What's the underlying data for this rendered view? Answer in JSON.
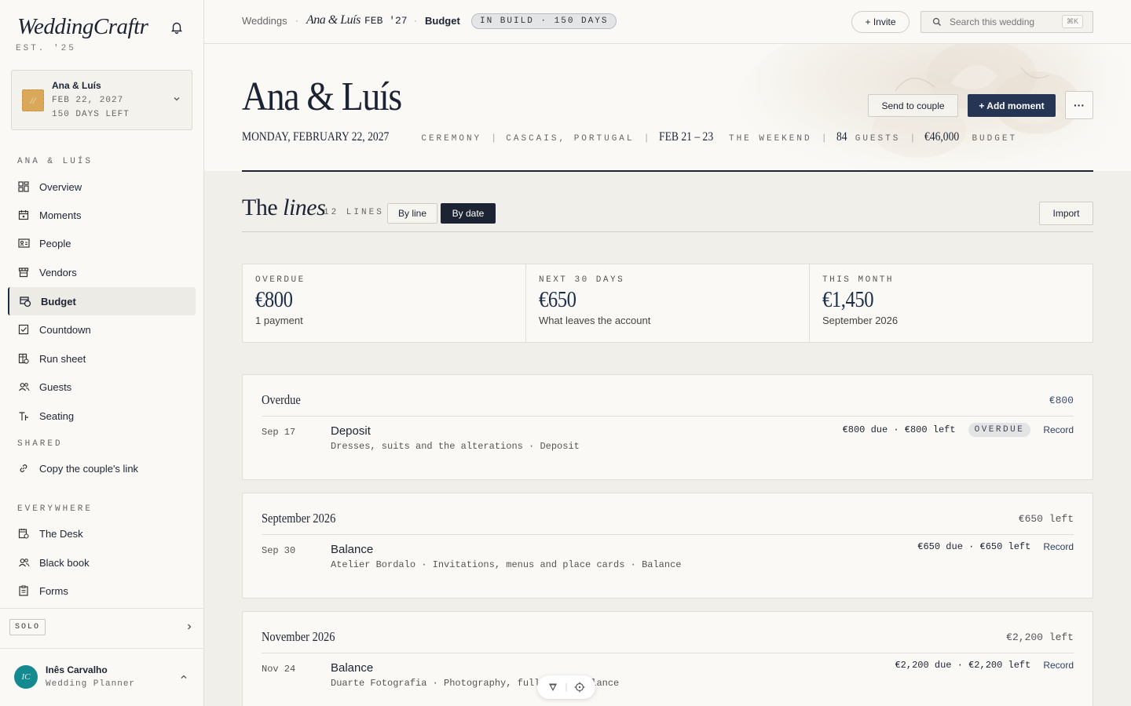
{
  "brand": {
    "name": "WeddingCraftr",
    "est": "EST. '25"
  },
  "wedding_card": {
    "monogram": "//",
    "name": "Ana & Luís",
    "date": "FEB 22, 2027",
    "days": "150 DAYS LEFT"
  },
  "nav": {
    "section_main": "ANA & LUÍS",
    "items": [
      {
        "label": "Overview",
        "icon": "grid-icon"
      },
      {
        "label": "Moments",
        "icon": "calendar-icon"
      },
      {
        "label": "People",
        "icon": "id-card-icon"
      },
      {
        "label": "Vendors",
        "icon": "store-icon"
      },
      {
        "label": "Budget",
        "icon": "budget-icon"
      },
      {
        "label": "Countdown",
        "icon": "checkbox-icon"
      },
      {
        "label": "Run sheet",
        "icon": "run-sheet-icon"
      },
      {
        "label": "Guests",
        "icon": "users-icon"
      },
      {
        "label": "Seating",
        "icon": "seating-icon"
      }
    ],
    "section_shared": "SHARED",
    "shared_items": [
      {
        "label": "Copy the couple's link",
        "icon": "link-icon"
      }
    ],
    "section_everywhere": "EVERYWHERE",
    "everywhere_items": [
      {
        "label": "The Desk",
        "icon": "desk-icon"
      },
      {
        "label": "Black book",
        "icon": "users-icon"
      },
      {
        "label": "Forms",
        "icon": "form-icon"
      }
    ]
  },
  "plan": {
    "label": "SOLO"
  },
  "user": {
    "initials": "IC",
    "name": "Inês Carvalho",
    "role": "Wedding Planner"
  },
  "topbar": {
    "crumb_root": "Weddings",
    "crumb_wedding": "Ana & Luís",
    "crumb_wedding_date": "FEB '27",
    "crumb_page": "Budget",
    "status_pill": "IN BUILD · 150 DAYS",
    "invite_label": "+ Invite",
    "search_placeholder": "Search this wedding",
    "search_kbd": "⌘K"
  },
  "hero": {
    "title": "Ana & Luís",
    "date": "MONDAY, FEBRUARY 22, 2027",
    "date_label": "CEREMONY",
    "location": "CASCAIS, PORTUGAL",
    "weekend": "FEB 21 – 23",
    "weekend_label": "THE WEEKEND",
    "guests": "84",
    "guests_label": "GUESTS",
    "budget": "€46,000",
    "budget_label": "BUDGET",
    "send_label": "Send to couple",
    "add_label": "+ Add moment",
    "more_label": "···"
  },
  "lines": {
    "title_a": "The ",
    "title_b": "lines",
    "count": "12 LINES",
    "by_line": "By line",
    "by_date": "By date",
    "import": "Import"
  },
  "stats": [
    {
      "label": "OVERDUE",
      "value": "€800",
      "sub": "1 payment"
    },
    {
      "label": "NEXT 30 DAYS",
      "value": "€650",
      "sub": "What leaves the account"
    },
    {
      "label": "THIS MONTH",
      "value": "€1,450",
      "sub": "September 2026"
    }
  ],
  "groups": [
    {
      "title": "Overdue",
      "total": "€800",
      "row": {
        "date": "Sep 17",
        "title": "Deposit",
        "sub": "Dresses, suits and the alterations · Deposit",
        "amount": "€800 due · €800 left",
        "badge": "OVERDUE",
        "action": "Record"
      }
    },
    {
      "title": "September 2026",
      "total": "€650 left",
      "row": {
        "date": "Sep 30",
        "title": "Balance",
        "sub": "Atelier Bordalo · Invitations, menus and place cards · Balance",
        "amount": "€650 due · €650 left",
        "action": "Record"
      }
    },
    {
      "title": "November 2026",
      "total": "€2,200 left",
      "row": {
        "date": "Nov 24",
        "title": "Balance",
        "sub": "Duarte Fotografia · Photography, full day · Balance",
        "amount": "€2,200 due · €2,200 left",
        "action": "Record"
      }
    }
  ],
  "colors": {
    "accent": "#253553",
    "ink": "#1c2333",
    "paper": "#faf9f5",
    "badge": "#d9a85b",
    "avatar": "#138a8f"
  }
}
